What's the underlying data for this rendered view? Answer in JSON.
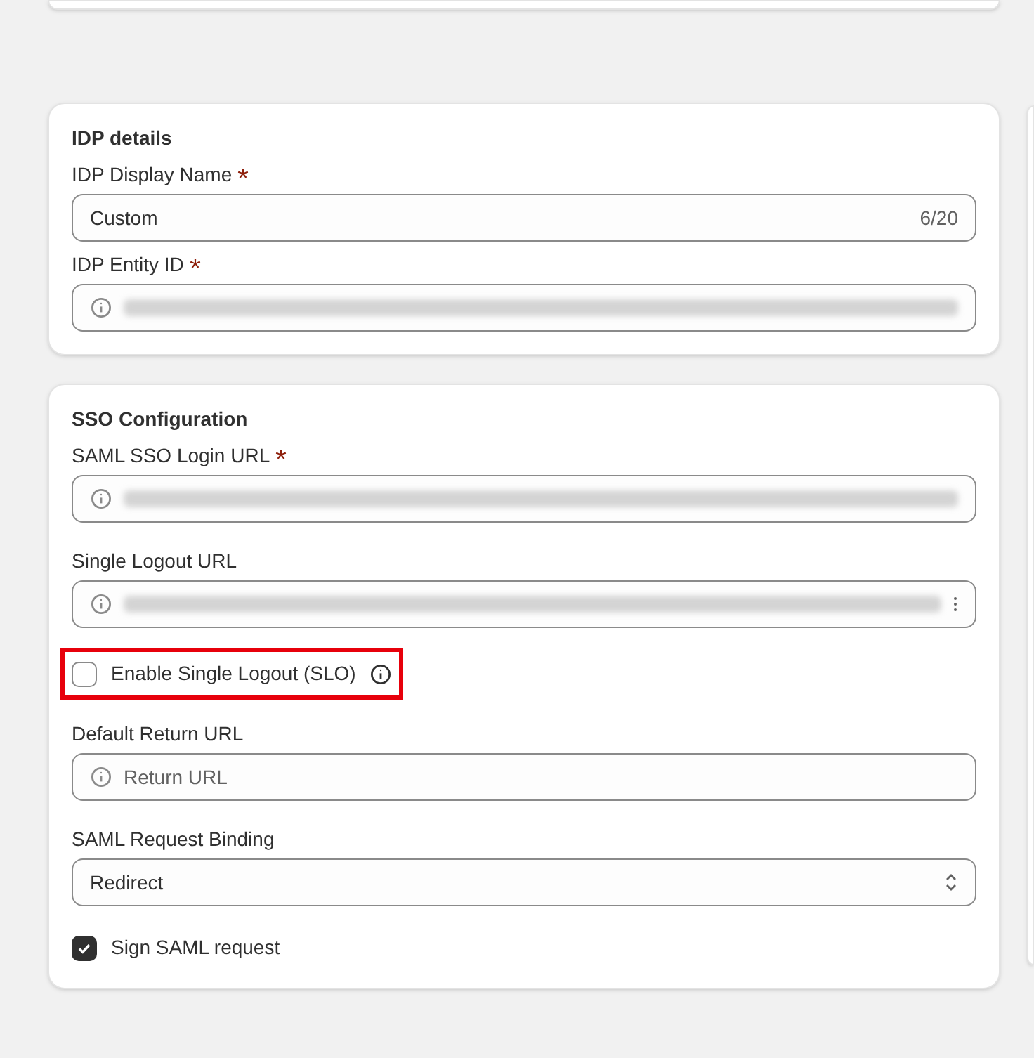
{
  "sections": [
    {
      "title": "IDP details",
      "fields": [
        {
          "kind": "text",
          "label": "IDP Display Name",
          "required": true,
          "value": "Custom",
          "counter": "6/20"
        },
        {
          "kind": "redacted",
          "label": "IDP Entity ID",
          "required": true,
          "more_icon": false
        }
      ]
    },
    {
      "title": "SSO Configuration",
      "fields": [
        {
          "kind": "redacted",
          "label": "SAML SSO Login URL",
          "required": true,
          "more_icon": false
        },
        {
          "kind": "redacted",
          "label": "Single Logout URL",
          "required": false,
          "more_icon": true
        },
        {
          "kind": "checkbox",
          "label": "Enable Single Logout (SLO)",
          "checked": false,
          "info": true,
          "highlighted": true
        },
        {
          "kind": "placeholder",
          "label": "Default Return URL",
          "required": false,
          "placeholder": "Return URL"
        },
        {
          "kind": "select",
          "label": "SAML Request Binding",
          "required": false,
          "value": "Redirect"
        },
        {
          "kind": "checkbox",
          "label": "Sign SAML request",
          "checked": true
        }
      ]
    }
  ]
}
